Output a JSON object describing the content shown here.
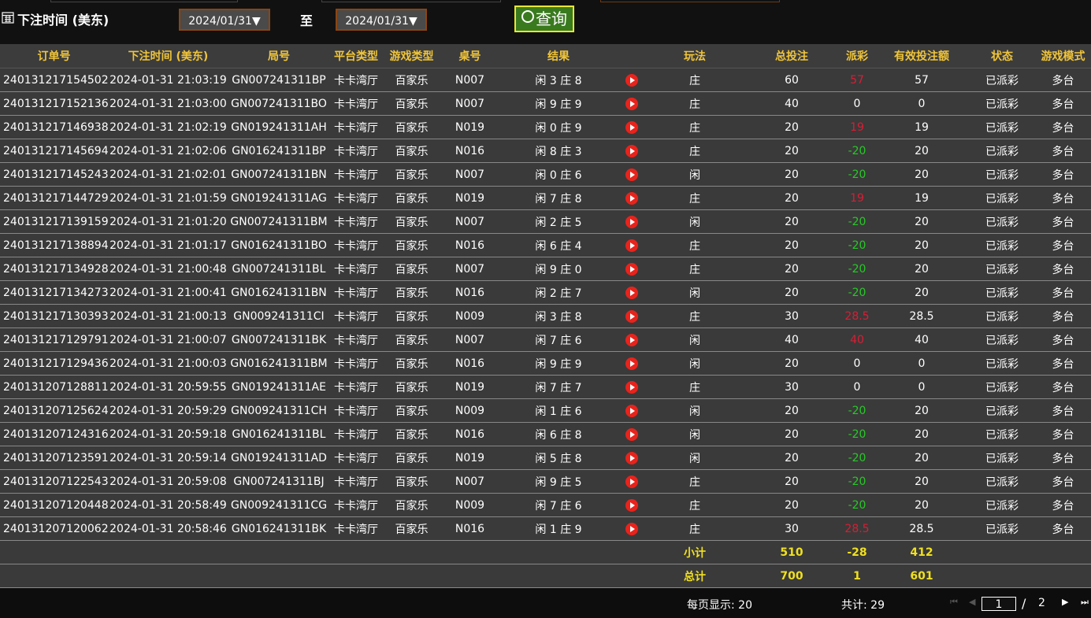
{
  "filter": {
    "label": "下注时间 (美东)",
    "date_from": "2024/01/31▼",
    "to_label": "至",
    "date_to": "2024/01/31▼",
    "query_label": "查询"
  },
  "columns": [
    "订单号",
    "下注时间 (美东)",
    "局号",
    "平台类型",
    "游戏类型",
    "桌号",
    "结果",
    "",
    "玩法",
    "总投注",
    "派彩",
    "有效投注额",
    "状态",
    "游戏模式"
  ],
  "rows": [
    {
      "order": "240131217154502",
      "time": "2024-01-31 21:03:19",
      "round": "GN007241311BP",
      "platform": "卡卡湾厅",
      "game": "百家乐",
      "table": "N007",
      "result": "闲 3 庄 8",
      "play": "庄",
      "bet": "60",
      "payout": "57",
      "payout_color": "#d81e35",
      "valid": "57",
      "status": "已派彩",
      "mode": "多台"
    },
    {
      "order": "240131217152136",
      "time": "2024-01-31 21:03:00",
      "round": "GN007241311BO",
      "platform": "卡卡湾厅",
      "game": "百家乐",
      "table": "N007",
      "result": "闲 9 庄 9",
      "play": "庄",
      "bet": "40",
      "payout": "0",
      "payout_color": "#ffffff",
      "valid": "0",
      "status": "已派彩",
      "mode": "多台"
    },
    {
      "order": "240131217146938",
      "time": "2024-01-31 21:02:19",
      "round": "GN019241311AH",
      "platform": "卡卡湾厅",
      "game": "百家乐",
      "table": "N019",
      "result": "闲 0 庄 9",
      "play": "庄",
      "bet": "20",
      "payout": "19",
      "payout_color": "#d81e35",
      "valid": "19",
      "status": "已派彩",
      "mode": "多台"
    },
    {
      "order": "240131217145694",
      "time": "2024-01-31 21:02:06",
      "round": "GN016241311BP",
      "platform": "卡卡湾厅",
      "game": "百家乐",
      "table": "N016",
      "result": "闲 8 庄 3",
      "play": "庄",
      "bet": "20",
      "payout": "-20",
      "payout_color": "#26c926",
      "valid": "20",
      "status": "已派彩",
      "mode": "多台"
    },
    {
      "order": "240131217145243",
      "time": "2024-01-31 21:02:01",
      "round": "GN007241311BN",
      "platform": "卡卡湾厅",
      "game": "百家乐",
      "table": "N007",
      "result": "闲 0 庄 6",
      "play": "闲",
      "bet": "20",
      "payout": "-20",
      "payout_color": "#26c926",
      "valid": "20",
      "status": "已派彩",
      "mode": "多台"
    },
    {
      "order": "240131217144729",
      "time": "2024-01-31 21:01:59",
      "round": "GN019241311AG",
      "platform": "卡卡湾厅",
      "game": "百家乐",
      "table": "N019",
      "result": "闲 7 庄 8",
      "play": "庄",
      "bet": "20",
      "payout": "19",
      "payout_color": "#d81e35",
      "valid": "19",
      "status": "已派彩",
      "mode": "多台"
    },
    {
      "order": "240131217139159",
      "time": "2024-01-31 21:01:20",
      "round": "GN007241311BM",
      "platform": "卡卡湾厅",
      "game": "百家乐",
      "table": "N007",
      "result": "闲 2 庄 5",
      "play": "闲",
      "bet": "20",
      "payout": "-20",
      "payout_color": "#26c926",
      "valid": "20",
      "status": "已派彩",
      "mode": "多台"
    },
    {
      "order": "240131217138894",
      "time": "2024-01-31 21:01:17",
      "round": "GN016241311BO",
      "platform": "卡卡湾厅",
      "game": "百家乐",
      "table": "N016",
      "result": "闲 6 庄 4",
      "play": "庄",
      "bet": "20",
      "payout": "-20",
      "payout_color": "#26c926",
      "valid": "20",
      "status": "已派彩",
      "mode": "多台"
    },
    {
      "order": "240131217134928",
      "time": "2024-01-31 21:00:48",
      "round": "GN007241311BL",
      "platform": "卡卡湾厅",
      "game": "百家乐",
      "table": "N007",
      "result": "闲 9 庄 0",
      "play": "庄",
      "bet": "20",
      "payout": "-20",
      "payout_color": "#26c926",
      "valid": "20",
      "status": "已派彩",
      "mode": "多台"
    },
    {
      "order": "240131217134273",
      "time": "2024-01-31 21:00:41",
      "round": "GN016241311BN",
      "platform": "卡卡湾厅",
      "game": "百家乐",
      "table": "N016",
      "result": "闲 2 庄 7",
      "play": "闲",
      "bet": "20",
      "payout": "-20",
      "payout_color": "#26c926",
      "valid": "20",
      "status": "已派彩",
      "mode": "多台"
    },
    {
      "order": "240131217130393",
      "time": "2024-01-31 21:00:13",
      "round": "GN009241311CI",
      "platform": "卡卡湾厅",
      "game": "百家乐",
      "table": "N009",
      "result": "闲 3 庄 8",
      "play": "庄",
      "bet": "30",
      "payout": "28.5",
      "payout_color": "#d81e35",
      "valid": "28.5",
      "status": "已派彩",
      "mode": "多台"
    },
    {
      "order": "240131217129791",
      "time": "2024-01-31 21:00:07",
      "round": "GN007241311BK",
      "platform": "卡卡湾厅",
      "game": "百家乐",
      "table": "N007",
      "result": "闲 7 庄 6",
      "play": "闲",
      "bet": "40",
      "payout": "40",
      "payout_color": "#d81e35",
      "valid": "40",
      "status": "已派彩",
      "mode": "多台"
    },
    {
      "order": "240131217129436",
      "time": "2024-01-31 21:00:03",
      "round": "GN016241311BM",
      "platform": "卡卡湾厅",
      "game": "百家乐",
      "table": "N016",
      "result": "闲 9 庄 9",
      "play": "闲",
      "bet": "20",
      "payout": "0",
      "payout_color": "#ffffff",
      "valid": "0",
      "status": "已派彩",
      "mode": "多台"
    },
    {
      "order": "240131207128811",
      "time": "2024-01-31 20:59:55",
      "round": "GN019241311AE",
      "platform": "卡卡湾厅",
      "game": "百家乐",
      "table": "N019",
      "result": "闲 7 庄 7",
      "play": "庄",
      "bet": "30",
      "payout": "0",
      "payout_color": "#ffffff",
      "valid": "0",
      "status": "已派彩",
      "mode": "多台"
    },
    {
      "order": "240131207125624",
      "time": "2024-01-31 20:59:29",
      "round": "GN009241311CH",
      "platform": "卡卡湾厅",
      "game": "百家乐",
      "table": "N009",
      "result": "闲 1 庄 6",
      "play": "闲",
      "bet": "20",
      "payout": "-20",
      "payout_color": "#26c926",
      "valid": "20",
      "status": "已派彩",
      "mode": "多台"
    },
    {
      "order": "240131207124316",
      "time": "2024-01-31 20:59:18",
      "round": "GN016241311BL",
      "platform": "卡卡湾厅",
      "game": "百家乐",
      "table": "N016",
      "result": "闲 6 庄 8",
      "play": "闲",
      "bet": "20",
      "payout": "-20",
      "payout_color": "#26c926",
      "valid": "20",
      "status": "已派彩",
      "mode": "多台"
    },
    {
      "order": "240131207123591",
      "time": "2024-01-31 20:59:14",
      "round": "GN019241311AD",
      "platform": "卡卡湾厅",
      "game": "百家乐",
      "table": "N019",
      "result": "闲 5 庄 8",
      "play": "闲",
      "bet": "20",
      "payout": "-20",
      "payout_color": "#26c926",
      "valid": "20",
      "status": "已派彩",
      "mode": "多台"
    },
    {
      "order": "240131207122543",
      "time": "2024-01-31 20:59:08",
      "round": "GN007241311BJ",
      "platform": "卡卡湾厅",
      "game": "百家乐",
      "table": "N007",
      "result": "闲 9 庄 5",
      "play": "庄",
      "bet": "20",
      "payout": "-20",
      "payout_color": "#26c926",
      "valid": "20",
      "status": "已派彩",
      "mode": "多台"
    },
    {
      "order": "240131207120448",
      "time": "2024-01-31 20:58:49",
      "round": "GN009241311CG",
      "platform": "卡卡湾厅",
      "game": "百家乐",
      "table": "N009",
      "result": "闲 7 庄 6",
      "play": "庄",
      "bet": "20",
      "payout": "-20",
      "payout_color": "#26c926",
      "valid": "20",
      "status": "已派彩",
      "mode": "多台"
    },
    {
      "order": "240131207120062",
      "time": "2024-01-31 20:58:46",
      "round": "GN016241311BK",
      "platform": "卡卡湾厅",
      "game": "百家乐",
      "table": "N016",
      "result": "闲 1 庄 9",
      "play": "庄",
      "bet": "30",
      "payout": "28.5",
      "payout_color": "#d81e35",
      "valid": "28.5",
      "status": "已派彩",
      "mode": "多台"
    }
  ],
  "subtotal": {
    "label": "小计",
    "bet": "510",
    "payout": "-28",
    "valid": "412"
  },
  "grandtotal": {
    "label": "总计",
    "bet": "700",
    "payout": "1",
    "valid": "601"
  },
  "pagination": {
    "per_page": "每页显示: 20",
    "total": "共计: 29",
    "current_page": "1",
    "slash": "/",
    "total_pages": "2"
  },
  "colors": {
    "header_text": "#f0c53a",
    "win": "#d81e35",
    "loss": "#26c926",
    "status": "#26c926",
    "total_text": "#f0e020",
    "query_border": "#e8e830",
    "query_bg": "#3a7a1f"
  }
}
